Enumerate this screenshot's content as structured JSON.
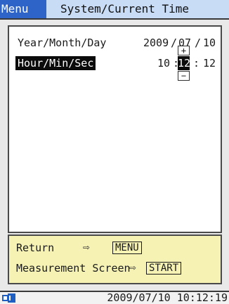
{
  "titlebar": {
    "menu_label": "Menu",
    "title": "System/Current Time",
    "accent": "#2e63c8"
  },
  "settings": {
    "date_label": "Year/Month/Day",
    "time_label": "Hour/Min/Sec",
    "year": "2009",
    "month": "07",
    "day": "10",
    "date_separator": "/",
    "hour": "10",
    "minute": "12",
    "second": "12",
    "time_separator": ":",
    "stepper_up": "+",
    "stepper_down": "−"
  },
  "help": {
    "return_label": "Return",
    "return_key": "MENU",
    "measure_label": "Measurement Screen",
    "measure_key": "START",
    "arrow_icon": "⇨",
    "background": "#f5f2b3"
  },
  "status": {
    "datetime": "2009/07/10 10:12:19",
    "icon": "power-plug-icon"
  }
}
